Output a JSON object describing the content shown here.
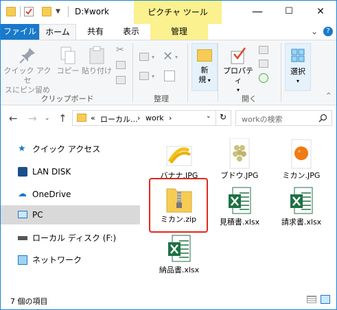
{
  "titlebar": {
    "path": "D:¥work",
    "context_tab": "ピクチャ ツール",
    "minimize": "—",
    "maximize": "☐",
    "close": "✕"
  },
  "tabs": {
    "file": "ファイル",
    "home": "ホーム",
    "share": "共有",
    "view": "表示",
    "manage": "管理"
  },
  "ribbon": {
    "pin_label_1": "クイック アクセ",
    "pin_label_2": "スにピン留め",
    "copy": "コピー",
    "paste": "貼り付け",
    "clipboard_group": "クリップボード",
    "organize_group": "整理",
    "new_label_1": "新",
    "new_label_2": "規",
    "properties": "プロパティ",
    "open_group": "開く",
    "select": "選択"
  },
  "address": {
    "prefix": "«",
    "crumb1": "ローカル...",
    "sep": "›",
    "crumb2": "work",
    "search_placeholder": "workの検索"
  },
  "navpane": {
    "items": [
      {
        "label": "クイック アクセス"
      },
      {
        "label": "LAN DISK"
      },
      {
        "label": "OneDrive"
      },
      {
        "label": "PC"
      },
      {
        "label": "ローカル ディスク (F:)"
      },
      {
        "label": "ネットワーク"
      }
    ]
  },
  "files": [
    {
      "name": "バナナ.JPG"
    },
    {
      "name": "ブドウ.JPG"
    },
    {
      "name": "ミカン.JPG"
    },
    {
      "name": "ミカン.zip"
    },
    {
      "name": "見積書.xlsx"
    },
    {
      "name": "請求書.xlsx"
    },
    {
      "name": "納品書.xlsx"
    }
  ],
  "status": {
    "count": "7 個の項目"
  },
  "colors": {
    "accent": "#1979ca",
    "context": "#fbf18f",
    "selection_outline": "#e3261b",
    "excel": "#1e7145"
  }
}
